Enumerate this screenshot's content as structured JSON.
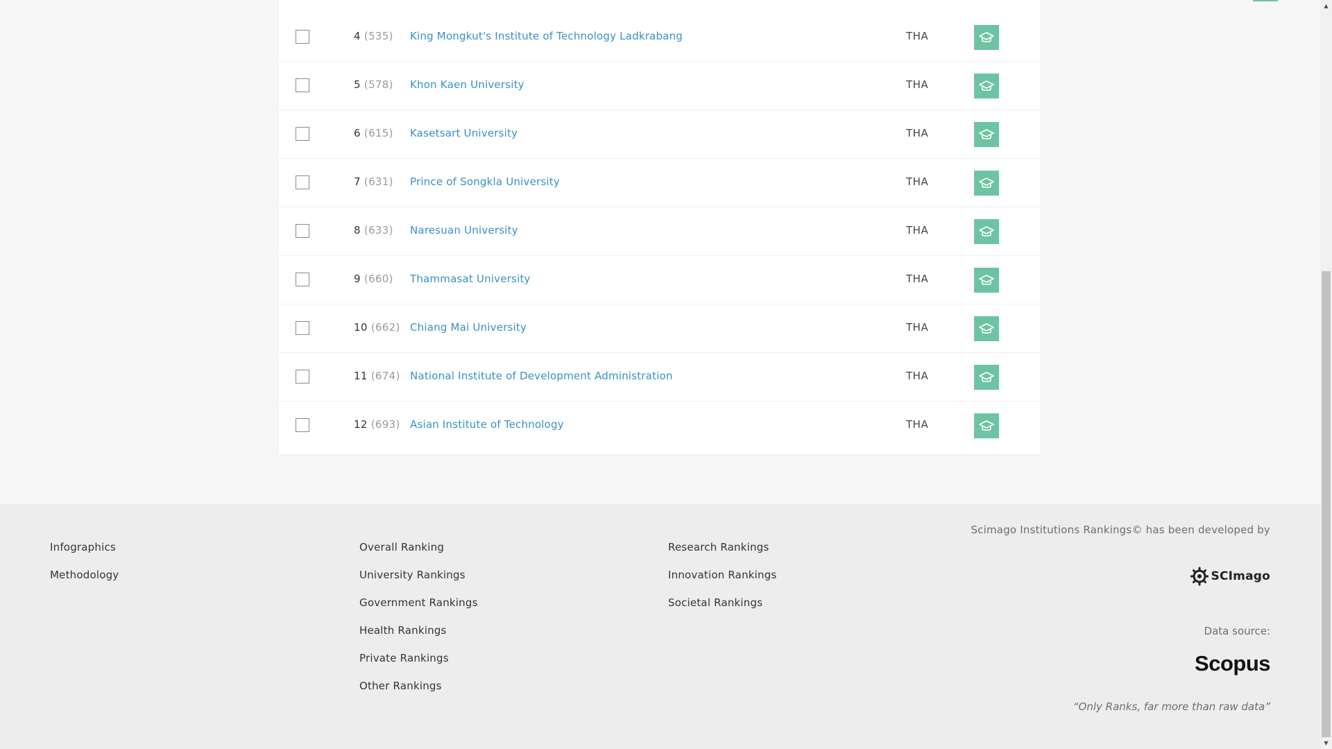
{
  "rankings": {
    "rows": [
      {
        "rank": "4",
        "world_rank": "(535)",
        "name": "King Mongkut's Institute of Technology Ladkrabang",
        "country": "THA",
        "sector_icon": "graduation-cap-icon"
      },
      {
        "rank": "5",
        "world_rank": "(578)",
        "name": "Khon Kaen University",
        "country": "THA",
        "sector_icon": "graduation-cap-icon"
      },
      {
        "rank": "6",
        "world_rank": "(615)",
        "name": "Kasetsart University",
        "country": "THA",
        "sector_icon": "graduation-cap-icon"
      },
      {
        "rank": "7",
        "world_rank": "(631)",
        "name": "Prince of Songkla University",
        "country": "THA",
        "sector_icon": "graduation-cap-icon"
      },
      {
        "rank": "8",
        "world_rank": "(633)",
        "name": "Naresuan University",
        "country": "THA",
        "sector_icon": "graduation-cap-icon"
      },
      {
        "rank": "9",
        "world_rank": "(660)",
        "name": "Thammasat University",
        "country": "THA",
        "sector_icon": "graduation-cap-icon"
      },
      {
        "rank": "10",
        "world_rank": "(662)",
        "name": "Chiang Mai University",
        "country": "THA",
        "sector_icon": "graduation-cap-icon"
      },
      {
        "rank": "11",
        "world_rank": "(674)",
        "name": "National Institute of Development Administration",
        "country": "THA",
        "sector_icon": "graduation-cap-icon"
      },
      {
        "rank": "12",
        "world_rank": "(693)",
        "name": "Asian Institute of Technology",
        "country": "THA",
        "sector_icon": "graduation-cap-icon"
      }
    ],
    "sector_color": "#6cc4a4",
    "link_color": "#3a8fc6"
  },
  "footer": {
    "col1": [
      "Infographics",
      "Methodology"
    ],
    "col2": [
      "Overall Ranking",
      "University Rankings",
      "Government Rankings",
      "Health Rankings",
      "Private Rankings",
      "Other Rankings"
    ],
    "col3": [
      "Research Rankings",
      "Innovation Rankings",
      "Societal Rankings"
    ],
    "developed_by": "Scimago Institutions Rankings© has been developed by",
    "scimago_logo": "SCImago",
    "data_source_label": "Data source:",
    "scopus_logo": "Scopus",
    "tagline": "“Only Ranks, far more than raw data”"
  }
}
